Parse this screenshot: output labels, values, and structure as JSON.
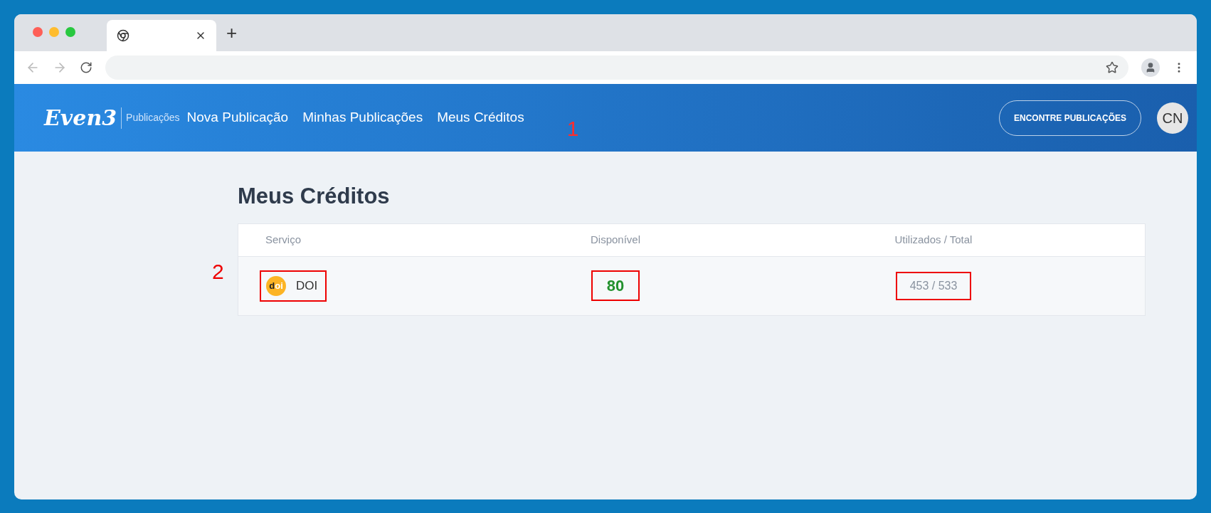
{
  "browser": {
    "new_tab": "+"
  },
  "header": {
    "logo": "Even3",
    "subtitle": "Publicações",
    "nav": [
      {
        "label": "Nova Publicação"
      },
      {
        "label": "Minhas Publicações"
      },
      {
        "label": "Meus Créditos"
      }
    ],
    "button": "ENCONTRE PUBLICAÇÕES",
    "avatar": "CN"
  },
  "page": {
    "title": "Meus Créditos",
    "table": {
      "columns": [
        "Serviço",
        "Disponível",
        "Utilizados / Total"
      ],
      "rows": [
        {
          "logo_parts": [
            "d",
            "oi"
          ],
          "service": "DOI",
          "available": "80",
          "used_total": "453 / 533"
        }
      ]
    }
  },
  "annotations": [
    {
      "label": "1"
    },
    {
      "label": "2"
    }
  ]
}
